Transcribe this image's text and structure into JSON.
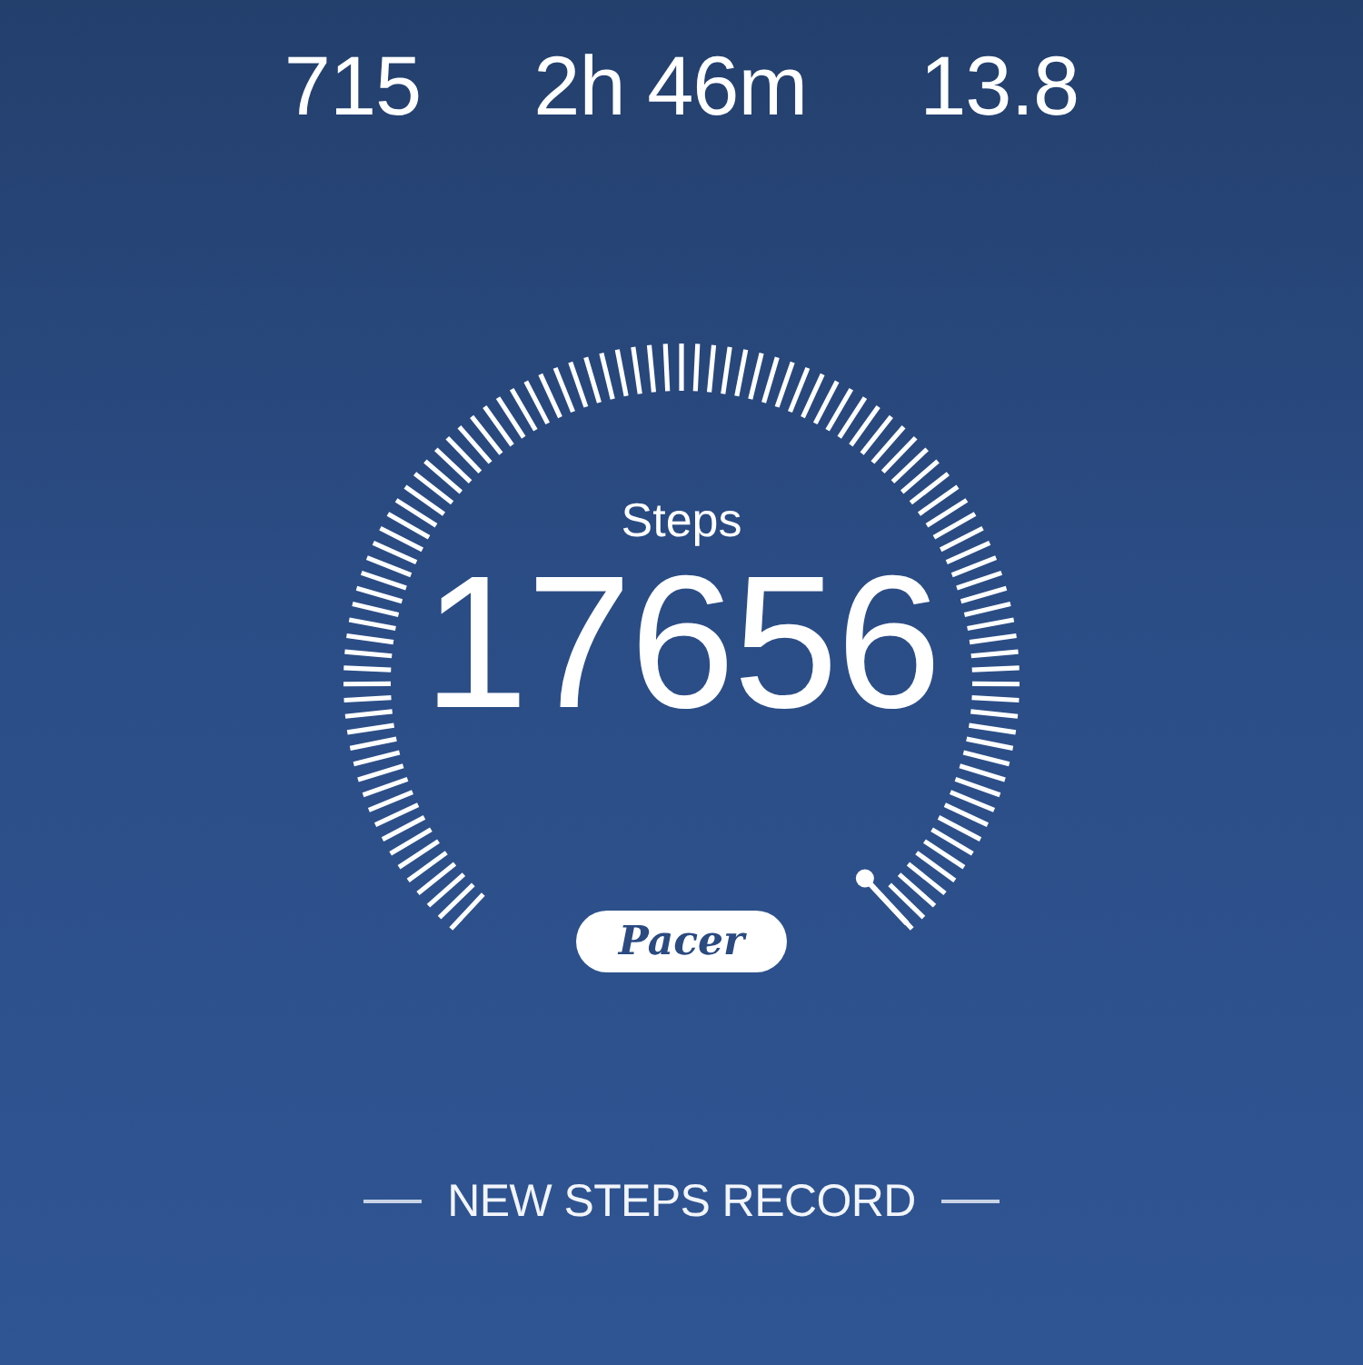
{
  "stats": [
    {
      "value": "715"
    },
    {
      "value": "2h 46m"
    },
    {
      "value": "13.8"
    }
  ],
  "gauge": {
    "label": "Steps",
    "value": "17656",
    "logo": "Pacer"
  },
  "record": {
    "text": "NEW STEPS RECORD"
  }
}
